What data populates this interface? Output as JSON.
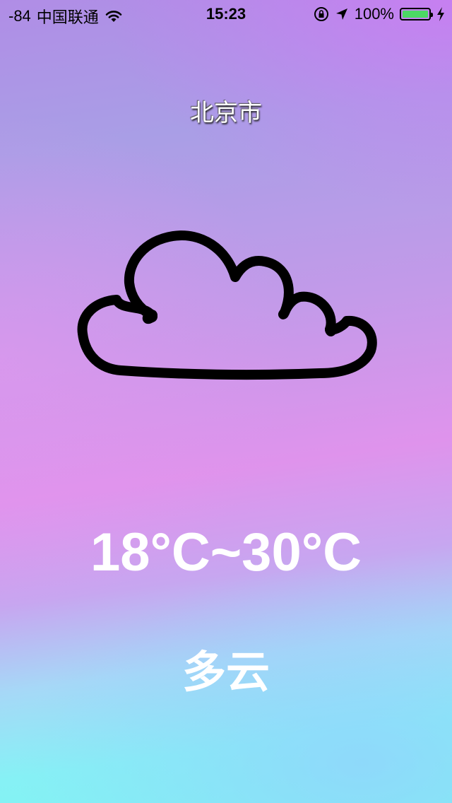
{
  "status_bar": {
    "signal": "-84",
    "carrier": "中国联通",
    "time": "15:23",
    "battery_percent": "100%",
    "battery_level": 1.0,
    "battery_color": "#4cd964",
    "icons": [
      "wifi-icon",
      "rotation-lock-icon",
      "location-arrow-icon",
      "battery-icon",
      "charging-bolt-icon"
    ]
  },
  "weather": {
    "city": "北京市",
    "icon": "cloud-icon",
    "temperature_range": "18°C~30°C",
    "condition": "多云"
  }
}
